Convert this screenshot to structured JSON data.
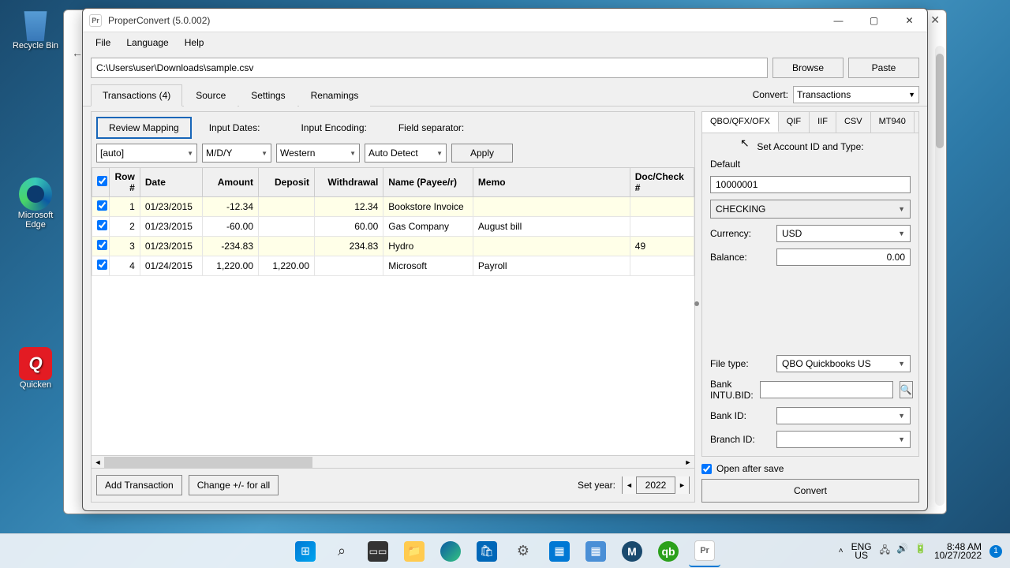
{
  "desktop": {
    "recycle": "Recycle Bin",
    "edge": "Microsoft Edge",
    "quicken": "Quicken"
  },
  "window": {
    "title": "ProperConvert (5.0.002)",
    "menu": {
      "file": "File",
      "language": "Language",
      "help": "Help"
    },
    "file_path": "C:\\Users\\user\\Downloads\\sample.csv",
    "browse": "Browse",
    "paste": "Paste"
  },
  "tabs": {
    "transactions": "Transactions (4)",
    "source": "Source",
    "settings": "Settings",
    "renamings": "Renamings"
  },
  "convert_label": "Convert:",
  "convert_select": "Transactions",
  "left": {
    "review": "Review Mapping",
    "input_dates": "Input Dates:",
    "input_encoding": "Input Encoding:",
    "field_separator": "Field separator:",
    "auto": "[auto]",
    "date_fmt": "M/D/Y",
    "encoding": "Western",
    "separator": "Auto Detect",
    "apply": "Apply",
    "headers": {
      "row": "Row #",
      "date": "Date",
      "amount": "Amount",
      "deposit": "Deposit",
      "withdrawal": "Withdrawal",
      "name": "Name (Payee/r)",
      "memo": "Memo",
      "doc": "Doc/Check #"
    },
    "rows": [
      {
        "n": "1",
        "date": "01/23/2015",
        "amount": "-12.34",
        "deposit": "",
        "withdrawal": "12.34",
        "name": "Bookstore Invoice",
        "memo": "",
        "doc": ""
      },
      {
        "n": "2",
        "date": "01/23/2015",
        "amount": "-60.00",
        "deposit": "",
        "withdrawal": "60.00",
        "name": "Gas Company",
        "memo": "August bill",
        "doc": ""
      },
      {
        "n": "3",
        "date": "01/23/2015",
        "amount": "-234.83",
        "deposit": "",
        "withdrawal": "234.83",
        "name": "Hydro",
        "memo": "",
        "doc": "49"
      },
      {
        "n": "4",
        "date": "01/24/2015",
        "amount": "1,220.00",
        "deposit": "1,220.00",
        "withdrawal": "",
        "name": "Microsoft",
        "memo": "Payroll",
        "doc": ""
      }
    ],
    "add_txn": "Add Transaction",
    "change_sign": "Change +/- for all",
    "set_year": "Set year:",
    "year": "2022"
  },
  "right": {
    "formats": {
      "qbo": "QBO/QFX/OFX",
      "qif": "QIF",
      "iif": "IIF",
      "csv": "CSV",
      "mt940": "MT940"
    },
    "set_account": "Set Account ID and Type:",
    "default": "Default",
    "account_id": "10000001",
    "account_type": "CHECKING",
    "currency_label": "Currency:",
    "currency": "USD",
    "balance_label": "Balance:",
    "balance": "0.00",
    "file_type_label": "File type:",
    "file_type": "QBO Quickbooks US",
    "bank_intu_label": "Bank INTU.BID:",
    "bank_id_label": "Bank ID:",
    "branch_id_label": "Branch ID:",
    "open_after": "Open after save",
    "convert": "Convert"
  },
  "taskbar": {
    "lang1": "ENG",
    "lang2": "US",
    "time": "8:48 AM",
    "date": "10/27/2022",
    "notif": "1"
  }
}
